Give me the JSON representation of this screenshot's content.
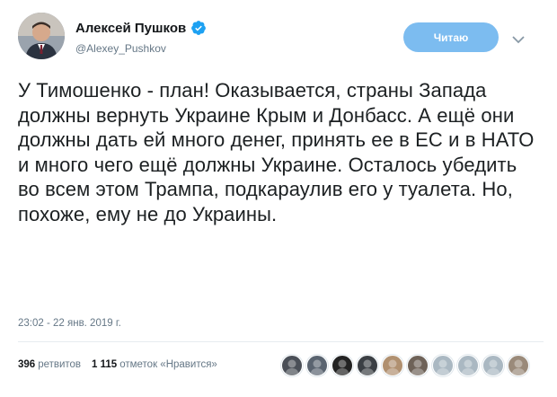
{
  "author": {
    "name": "Алексей Пушков",
    "handle": "@Alexey_Pushkov",
    "verified_icon": "verified-badge-icon",
    "avatar_icon": "user-avatar"
  },
  "follow_button": {
    "label": "Читаю"
  },
  "menu": {
    "icon": "chevron-down-icon"
  },
  "tweet": {
    "text": "У Тимошенко - план!  Оказывается, страны Запада должны вернуть Украине Крым и Донбасс. А ещё они должны дать ей много денег, принять ее в ЕС и в НАТО и много чего ещё должны Украине. Осталось убедить во всем этом Трампа, подкараулив его у туалета. Но, похоже, ему не до Украины.",
    "timestamp": "23:02 - 22 янв. 2019 г."
  },
  "stats": {
    "retweets_count": "396",
    "retweets_label": "ретвитов",
    "likes_count": "1 115",
    "likes_label": "отметок «Нравится»"
  },
  "likers": [
    {
      "color": "#4a4f57"
    },
    {
      "color": "#5a6470"
    },
    {
      "color": "#222222"
    },
    {
      "color": "#3b3f44"
    },
    {
      "color": "#b09070"
    },
    {
      "color": "#6e6258"
    },
    {
      "color": "#aab8c2"
    },
    {
      "color": "#aab8c2"
    },
    {
      "color": "#aab8c2"
    },
    {
      "color": "#9a8a7a"
    }
  ],
  "colors": {
    "accent": "#1da1f2",
    "follow_bg": "#7cbcf0",
    "muted": "#657786"
  }
}
